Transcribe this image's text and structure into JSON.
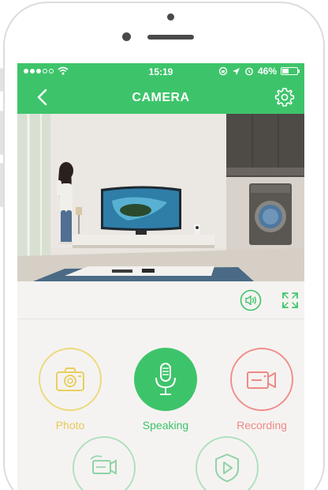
{
  "status_bar": {
    "time": "15:19",
    "battery": "46%",
    "battery_level": 0.46
  },
  "header": {
    "title": "CAMERA"
  },
  "actions": {
    "photo": {
      "label": "Photo",
      "color": "#ecd97a"
    },
    "speaking": {
      "label": "Speaking",
      "color": "#3dc46a"
    },
    "recording": {
      "label": "Recording",
      "color": "#ef8f8c"
    },
    "record_list": {
      "color": "#aee0c0"
    },
    "playback": {
      "color": "#aee0c0"
    }
  },
  "icons": {
    "back": "chevron-left-icon",
    "settings": "gear-icon",
    "volume": "speaker-icon",
    "fullscreen": "fullscreen-icon",
    "photo": "camera-icon",
    "speaking": "microphone-icon",
    "recording": "video-camera-icon",
    "record_list": "video-record-icon",
    "playback": "play-shield-icon"
  },
  "colors": {
    "accent": "#3dc46a",
    "background": "#f5f3f1",
    "toolbar_icon": "#3dc46a"
  }
}
